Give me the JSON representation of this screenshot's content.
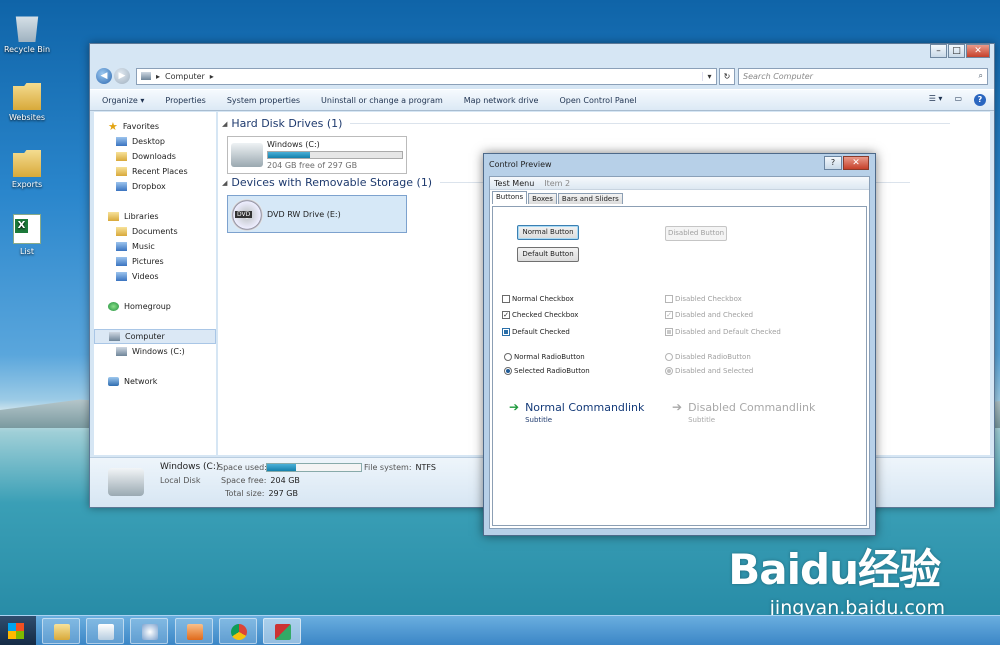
{
  "desktop": {
    "icons": [
      {
        "label": "Recycle Bin",
        "icon": "recycle-bin-icon"
      },
      {
        "label": "Websites",
        "icon": "folder-icon"
      },
      {
        "label": "Exports",
        "icon": "folder-icon"
      },
      {
        "label": "List",
        "icon": "excel-file-icon"
      }
    ],
    "watermark": "Baidu经验",
    "watermark_url": "jingyan.baidu.com"
  },
  "explorer": {
    "address": {
      "root": "Computer"
    },
    "search_placeholder": "Search Computer",
    "toolbar": {
      "organize": "Organize ▾",
      "properties": "Properties",
      "system_properties": "System properties",
      "uninstall": "Uninstall or change a program",
      "map_drive": "Map network drive",
      "control_panel": "Open Control Panel"
    },
    "nav": {
      "favorites": "Favorites",
      "desktop": "Desktop",
      "downloads": "Downloads",
      "recent": "Recent Places",
      "dropbox": "Dropbox",
      "libraries": "Libraries",
      "documents": "Documents",
      "music": "Music",
      "pictures": "Pictures",
      "videos": "Videos",
      "homegroup": "Homegroup",
      "computer": "Computer",
      "windows_c": "Windows (C:)",
      "network": "Network"
    },
    "groups": {
      "hdd": "Hard Disk Drives (1)",
      "removable": "Devices with Removable Storage (1)"
    },
    "drives": {
      "c_name": "Windows (C:)",
      "c_free": "204 GB free of 297 GB",
      "c_used_fraction": 0.31,
      "dvd_name": "DVD RW Drive (E:)",
      "dvd_label": "DVD"
    },
    "details": {
      "name": "Windows (C:)",
      "type": "Local Disk",
      "space_used_label": "Space used:",
      "space_free_label": "Space free:",
      "space_free": "204 GB",
      "total_label": "Total size:",
      "total": "297 GB",
      "fs_label": "File system:",
      "fs": "NTFS"
    }
  },
  "dialog": {
    "title": "Control Preview",
    "help": "?",
    "menu": [
      "Test Menu",
      "Item 2"
    ],
    "tabs": [
      "Buttons",
      "Boxes",
      "Bars and Sliders"
    ],
    "buttons": {
      "normal": "Normal Button",
      "default": "Default Button",
      "disabled": "Disabled Button"
    },
    "checkboxes": {
      "normal": "Normal Checkbox",
      "checked": "Checked Checkbox",
      "default_checked": "Default Checked",
      "disabled": "Disabled Checkbox",
      "disabled_checked": "Disabled and Checked",
      "disabled_default": "Disabled and Default Checked"
    },
    "radios": {
      "normal": "Normal RadioButton",
      "selected": "Selected RadioButton",
      "disabled": "Disabled RadioButton",
      "disabled_selected": "Disabled and Selected"
    },
    "commandlinks": {
      "normal": "Normal Commandlink",
      "normal_sub": "Subtitle",
      "disabled": "Disabled Commandlink",
      "disabled_sub": "Subtitle"
    }
  },
  "taskbar": {
    "apps": [
      "explorer-icon",
      "notepad-icon",
      "network-icon",
      "media-player-icon",
      "chrome-icon",
      "tool-icon"
    ]
  }
}
